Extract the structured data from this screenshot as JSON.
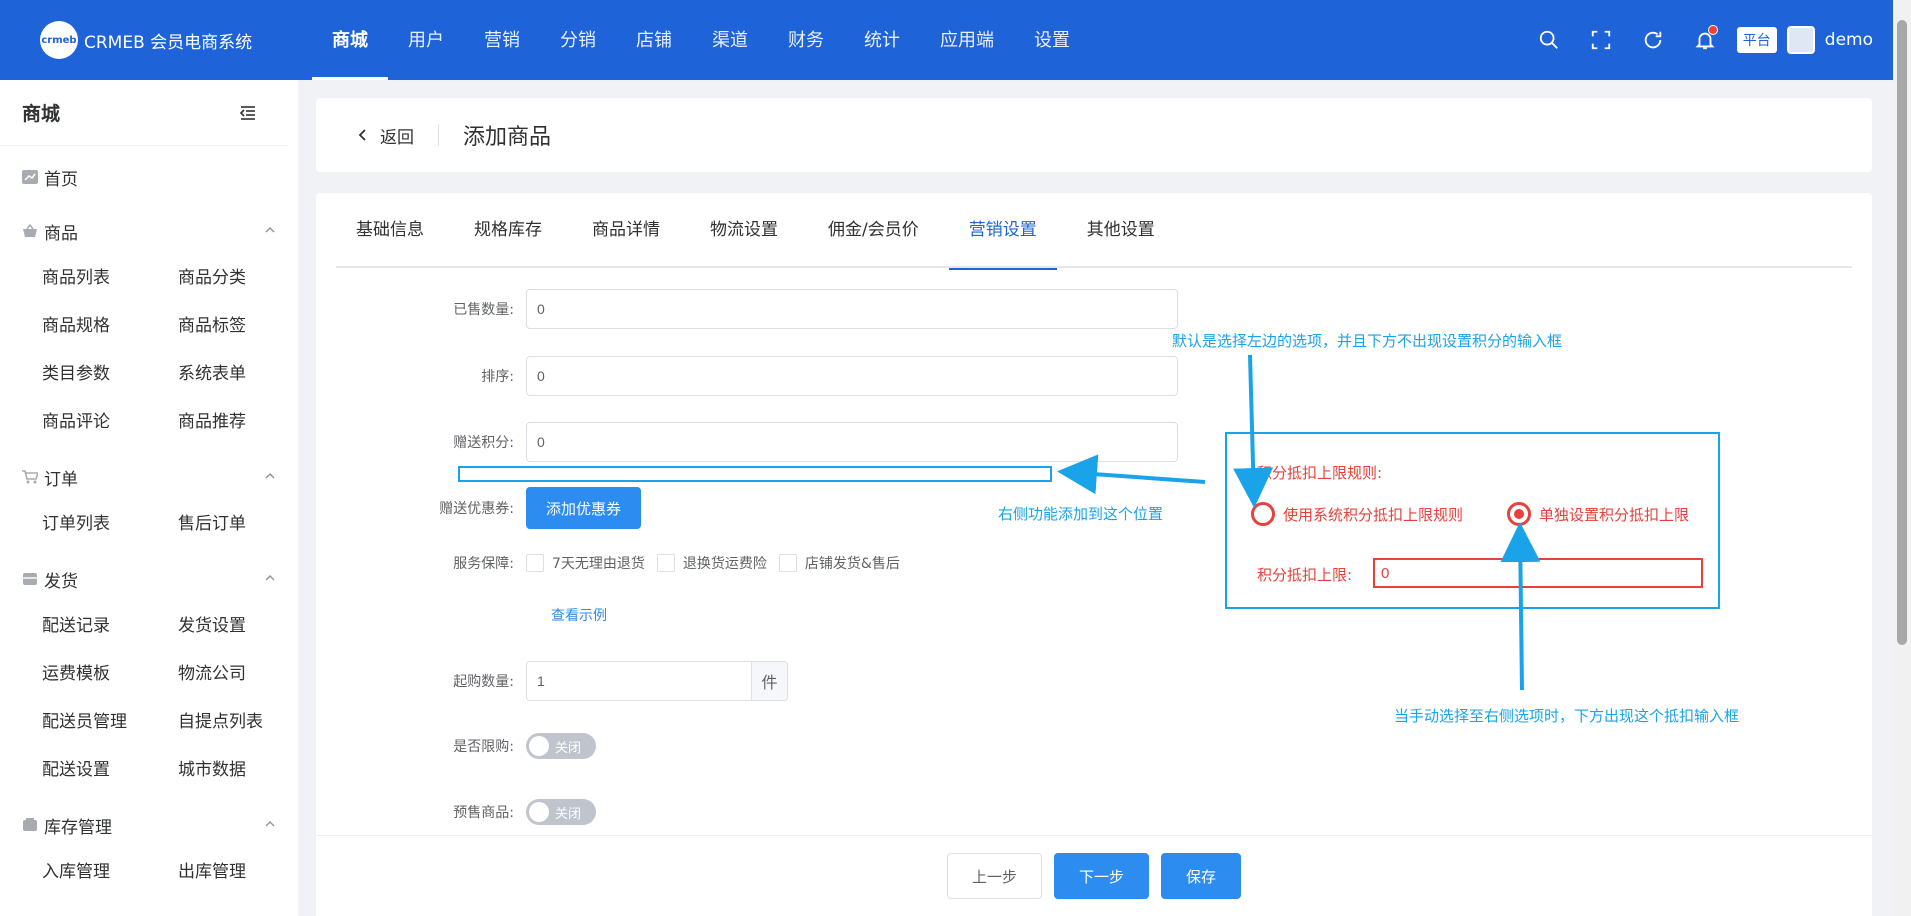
{
  "app": {
    "logo_mark": "crmeb",
    "logo_text": "CRMEB 会员电商系统"
  },
  "top_nav": [
    {
      "label": "商城"
    },
    {
      "label": "用户"
    },
    {
      "label": "营销"
    },
    {
      "label": "分销"
    },
    {
      "label": "店铺"
    },
    {
      "label": "渠道"
    },
    {
      "label": "财务"
    },
    {
      "label": "统计"
    },
    {
      "label": "应用端"
    },
    {
      "label": "设置"
    }
  ],
  "top_right": {
    "platform": "平台",
    "username": "demo"
  },
  "sidebar": {
    "title": "商城",
    "home": "首页",
    "groups": [
      {
        "label": "商品",
        "items": [
          "商品列表",
          "商品分类",
          "商品规格",
          "商品标签",
          "类目参数",
          "系统表单",
          "商品评论",
          "商品推荐"
        ]
      },
      {
        "label": "订单",
        "items": [
          "订单列表",
          "售后订单"
        ]
      },
      {
        "label": "发货",
        "items": [
          "配送记录",
          "发货设置",
          "运费模板",
          "物流公司",
          "配送员管理",
          "自提点列表",
          "配送设置",
          "城市数据"
        ]
      },
      {
        "label": "库存管理",
        "items": [
          "入库管理",
          "出库管理"
        ]
      }
    ]
  },
  "header": {
    "back": "返回",
    "title": "添加商品"
  },
  "tabs": [
    {
      "label": "基础信息"
    },
    {
      "label": "规格库存"
    },
    {
      "label": "商品详情"
    },
    {
      "label": "物流设置"
    },
    {
      "label": "佣金/会员价"
    },
    {
      "label": "营销设置"
    },
    {
      "label": "其他设置"
    }
  ],
  "form": {
    "sold_label": "已售数量:",
    "sold_value": "0",
    "sort_label": "排序:",
    "sort_value": "0",
    "points_label": "赠送积分:",
    "points_value": "0",
    "coupon_label": "赠送优惠券:",
    "coupon_button": "添加优惠券",
    "service_label": "服务保障:",
    "service_options": [
      "7天无理由退货",
      "退换货运费险",
      "店铺发货&售后"
    ],
    "service_example": "查看示例",
    "min_buy_label": "起购数量:",
    "min_buy_value": "1",
    "min_buy_unit": "件",
    "limit_label": "是否限购:",
    "limit_state": "关闭",
    "presale_label": "预售商品:",
    "presale_state": "关闭"
  },
  "footer": {
    "prev": "上一步",
    "next": "下一步",
    "save": "保存"
  },
  "annotation": {
    "top_note": "默认是选择左边的选项，并且下方不出现设置积分的输入框",
    "left_note": "右侧功能添加到这个位置",
    "bottom_note": "当手动选择至右侧选项时，下方出现这个抵扣输入框",
    "rule_label": "积分抵扣上限规则:",
    "option_system": "使用系统积分抵扣上限规则",
    "option_custom": "单独设置积分抵扣上限",
    "limit_label": "积分抵扣上限:",
    "limit_value": "0",
    "colors": {
      "annotation": "#1aa3e8",
      "highlight": "#e8403a"
    }
  },
  "colors": {
    "header": "#1e63d8",
    "primary": "#2d8cf0"
  }
}
